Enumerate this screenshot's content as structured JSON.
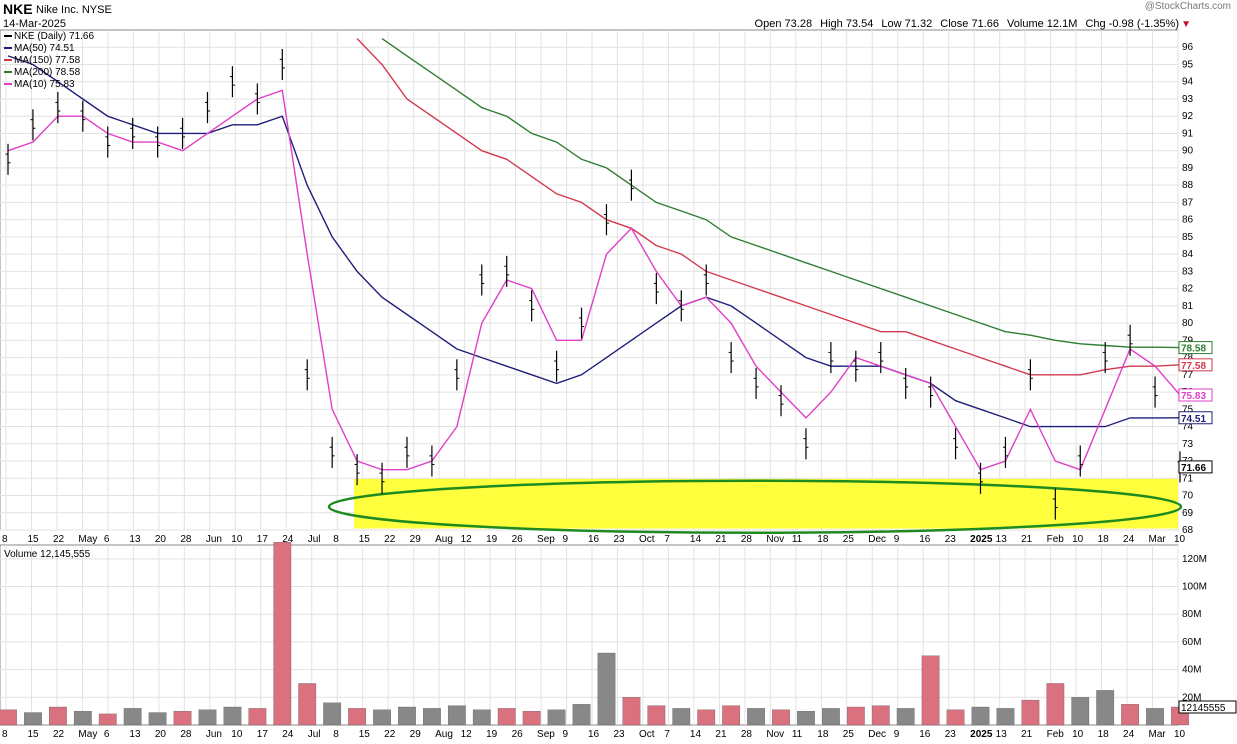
{
  "header": {
    "ticker": "NKE",
    "company": "Nike Inc.",
    "exchange": "NYSE",
    "date": "14-Mar-2025",
    "watermark": "@StockCharts.com",
    "open_label": "Open",
    "open": "73.28",
    "high_label": "High",
    "high": "73.54",
    "low_label": "Low",
    "low": "71.32",
    "close_label": "Close",
    "close": "71.66",
    "volume_label": "Volume",
    "volume": "12.1M",
    "chg_label": "Chg",
    "chg": "-0.98 (-1.35%)"
  },
  "legend": [
    {
      "text": "NKE (Daily) 71.66",
      "color": "#000000"
    },
    {
      "text": "MA(50) 74.51",
      "color": "#1f1f7a"
    },
    {
      "text": "MA(150) 77.58",
      "color": "#d23a4e"
    },
    {
      "text": "MA(200) 78.58",
      "color": "#2e7d32"
    },
    {
      "text": "MA(10) 75.83",
      "color": "#e040c8"
    }
  ],
  "volume_legend": "Volume 12,145,555",
  "chart_data": [
    {
      "type": "line",
      "title": "NKE Nike Inc. NYSE",
      "ylim": [
        68,
        97
      ],
      "x_ticks": [
        "8",
        "15",
        "22",
        "May",
        "6",
        "13",
        "20",
        "28",
        "Jun",
        "10",
        "17",
        "24",
        "Jul",
        "8",
        "15",
        "22",
        "29",
        "Aug",
        "12",
        "19",
        "26",
        "Sep",
        "9",
        "16",
        "23",
        "Oct",
        "7",
        "14",
        "21",
        "28",
        "Nov",
        "11",
        "18",
        "25",
        "Dec",
        "9",
        "16",
        "23",
        "2025",
        "13",
        "21",
        "Feb",
        "10",
        "18",
        "24",
        "Mar",
        "10"
      ],
      "y_ticks": [
        68,
        69,
        70,
        71,
        72,
        73,
        74,
        75,
        76,
        77,
        78,
        79,
        80,
        81,
        82,
        83,
        84,
        85,
        86,
        87,
        88,
        89,
        90,
        91,
        92,
        93,
        94,
        95,
        96
      ],
      "x": [
        "Apr 8",
        "Apr 15",
        "Apr 22",
        "May 1",
        "May 6",
        "May 13",
        "May 20",
        "May 28",
        "Jun 3",
        "Jun 10",
        "Jun 17",
        "Jun 24",
        "Jul 1",
        "Jul 8",
        "Jul 15",
        "Jul 22",
        "Jul 29",
        "Aug 5",
        "Aug 12",
        "Aug 19",
        "Aug 26",
        "Sep 3",
        "Sep 9",
        "Sep 16",
        "Sep 23",
        "Oct 1",
        "Oct 7",
        "Oct 14",
        "Oct 21",
        "Oct 28",
        "Nov 4",
        "Nov 11",
        "Nov 18",
        "Nov 25",
        "Dec 2",
        "Dec 9",
        "Dec 16",
        "Dec 23",
        "Jan 2",
        "Jan 13",
        "Jan 21",
        "Feb 3",
        "Feb 10",
        "Feb 18",
        "Feb 24",
        "Mar 3",
        "Mar 10",
        "Mar 14"
      ],
      "series": [
        {
          "name": "NKE (Daily)",
          "color": "#000000",
          "values": [
            89.5,
            91.5,
            92.5,
            92.0,
            90.5,
            91.0,
            90.5,
            91.0,
            92.5,
            94.0,
            93.0,
            95.0,
            77.0,
            72.5,
            71.5,
            71.0,
            72.5,
            72.0,
            77.0,
            82.5,
            83.0,
            81.0,
            77.5,
            80.0,
            86.0,
            88.0,
            82.0,
            81.0,
            82.5,
            78.0,
            76.5,
            75.5,
            73.0,
            78.0,
            77.5,
            78.0,
            76.5,
            76.0,
            73.0,
            71.0,
            72.5,
            77.0,
            69.5,
            72.0,
            78.0,
            79.0,
            76.0,
            71.66
          ]
        },
        {
          "name": "MA(50)",
          "color": "#1f1f7a",
          "values": [
            95.5,
            95.0,
            94.0,
            93.0,
            92.0,
            91.5,
            91.0,
            91.0,
            91.0,
            91.5,
            91.5,
            92.0,
            88.0,
            85.0,
            83.0,
            81.5,
            80.5,
            79.5,
            78.5,
            78.0,
            77.5,
            77.0,
            76.5,
            77.0,
            78.0,
            79.0,
            80.0,
            81.0,
            81.5,
            81.0,
            80.0,
            79.0,
            78.0,
            77.5,
            77.5,
            77.5,
            77.0,
            76.5,
            75.5,
            75.0,
            74.5,
            74.0,
            74.0,
            74.0,
            74.0,
            74.5,
            74.5,
            74.51
          ]
        },
        {
          "name": "MA(150)",
          "color": "#d23a4e",
          "values": [
            null,
            null,
            null,
            null,
            null,
            null,
            null,
            null,
            null,
            null,
            null,
            null,
            null,
            null,
            96.5,
            95.0,
            93.0,
            92.0,
            91.0,
            90.0,
            89.5,
            88.5,
            87.5,
            87.0,
            86.0,
            85.5,
            84.5,
            84.0,
            83.0,
            82.5,
            82.0,
            81.5,
            81.0,
            80.5,
            80.0,
            79.5,
            79.5,
            79.0,
            78.5,
            78.0,
            77.5,
            77.0,
            77.0,
            77.0,
            77.3,
            77.5,
            77.5,
            77.58
          ]
        },
        {
          "name": "MA(200)",
          "color": "#2e7d32",
          "values": [
            null,
            null,
            null,
            null,
            null,
            null,
            null,
            null,
            null,
            null,
            null,
            null,
            null,
            null,
            null,
            96.5,
            95.5,
            94.5,
            93.5,
            92.5,
            92.0,
            91.0,
            90.5,
            89.5,
            89.0,
            88.0,
            87.0,
            86.5,
            86.0,
            85.0,
            84.5,
            84.0,
            83.5,
            83.0,
            82.5,
            82.0,
            81.5,
            81.0,
            80.5,
            80.0,
            79.5,
            79.3,
            79.0,
            78.8,
            78.7,
            78.6,
            78.6,
            78.58
          ]
        },
        {
          "name": "MA(10)",
          "color": "#e040c8",
          "values": [
            90.0,
            90.5,
            92.0,
            92.0,
            91.0,
            90.5,
            90.5,
            90.0,
            91.0,
            92.0,
            93.0,
            93.5,
            84.0,
            75.0,
            72.0,
            71.5,
            71.5,
            72.0,
            74.0,
            80.0,
            82.5,
            82.0,
            79.0,
            79.0,
            84.0,
            85.5,
            83.0,
            81.0,
            81.5,
            80.0,
            77.5,
            76.0,
            74.5,
            76.0,
            78.0,
            77.5,
            77.0,
            76.5,
            74.0,
            71.5,
            72.0,
            75.0,
            72.0,
            71.5,
            75.0,
            78.5,
            77.5,
            75.83
          ]
        }
      ],
      "price_labels": [
        {
          "value": 78.58,
          "text": "78.58",
          "color": "#2e7d32"
        },
        {
          "value": 77.58,
          "text": "77.58",
          "color": "#d23a4e"
        },
        {
          "value": 75.83,
          "text": "75.83",
          "color": "#e040c8"
        },
        {
          "value": 74.51,
          "text": "74.51",
          "color": "#1f1f7a"
        },
        {
          "value": 71.66,
          "text": "71.66",
          "color": "#000000"
        }
      ],
      "support_zone": {
        "low": 68.2,
        "high": 70.5,
        "color": "#ffff33",
        "ellipse_color": "#1f8a1f"
      },
      "grid": true
    },
    {
      "type": "bar",
      "title": "Volume 12,145,555",
      "ylim": [
        0,
        130
      ],
      "y_ticks": [
        20,
        40,
        60,
        80,
        100,
        120
      ],
      "y_tick_labels": [
        "20M",
        "40M",
        "60M",
        "80M",
        "100M",
        "120M"
      ],
      "last_value_label": "12145555",
      "up_color": "#888888",
      "down_color": "#d9717e",
      "values": [
        11,
        9,
        13,
        10,
        8,
        12,
        9,
        10,
        11,
        13,
        12,
        132,
        30,
        16,
        12,
        11,
        13,
        12,
        14,
        11,
        12,
        10,
        11,
        15,
        52,
        20,
        14,
        12,
        11,
        14,
        12,
        11,
        10,
        12,
        13,
        14,
        12,
        50,
        11,
        13,
        12,
        18,
        30,
        20,
        25,
        15,
        12,
        13
      ],
      "up": [
        false,
        true,
        false,
        true,
        false,
        true,
        true,
        false,
        true,
        true,
        false,
        false,
        false,
        true,
        false,
        true,
        true,
        true,
        true,
        true,
        false,
        false,
        true,
        true,
        true,
        false,
        false,
        true,
        false,
        false,
        true,
        false,
        true,
        true,
        false,
        false,
        true,
        false,
        false,
        true,
        true,
        false,
        false,
        true,
        true,
        false,
        true,
        false
      ]
    }
  ]
}
